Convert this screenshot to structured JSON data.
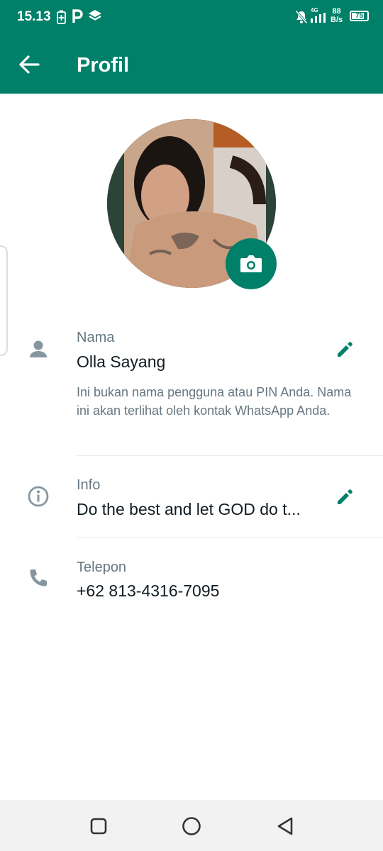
{
  "status_bar": {
    "time": "15.13",
    "network_type": "4G",
    "net_speed_value": "88",
    "net_speed_unit": "B/s",
    "battery": "75"
  },
  "app_bar": {
    "title": "Profil"
  },
  "profile": {
    "name_label": "Nama",
    "name_value": "Olla Sayang",
    "name_hint": "Ini bukan nama pengguna atau PIN Anda. Nama ini akan terlihat oleh kontak WhatsApp Anda.",
    "about_label": "Info",
    "about_value": "Do the best and let GOD do t...",
    "phone_label": "Telepon",
    "phone_value": "+62 813-4316-7095"
  },
  "colors": {
    "brand": "#008069",
    "label_gray": "#667781",
    "text_dark": "#111b21"
  },
  "icons": [
    "back-arrow-icon",
    "camera-icon",
    "person-icon",
    "info-icon",
    "phone-icon",
    "pencil-icon",
    "square-nav-icon",
    "circle-nav-icon",
    "triangle-back-nav-icon"
  ]
}
